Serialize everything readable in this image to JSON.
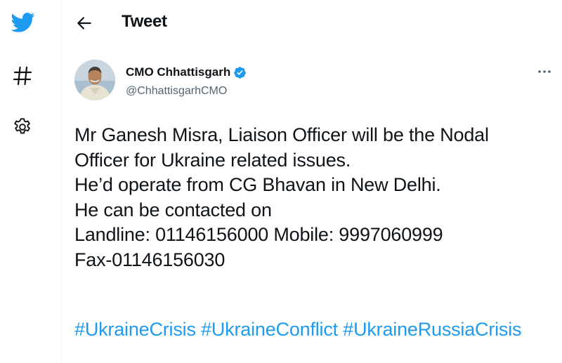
{
  "header": {
    "title": "Tweet"
  },
  "icons": {
    "logo": "twitter-bird-icon",
    "explore": "hashtag-icon",
    "settings": "gear-icon",
    "back": "back-arrow-icon",
    "verified": "verified-badge-icon",
    "more": "more-dots-icon"
  },
  "colors": {
    "accent": "#1d9bf0",
    "text": "#0f1419",
    "secondary_text": "#536471"
  },
  "tweet": {
    "author": {
      "display_name": "CMO Chhattisgarh",
      "handle": "@ChhattisgarhCMO",
      "verified": true
    },
    "lines": [
      "Mr Ganesh Misra, Liaison Officer will be the Nodal",
      "Officer for Ukraine related issues.",
      "He’d operate from CG Bhavan in New Delhi.",
      "He can be contacted on",
      "Landline:  01146156000 Mobile: 9997060999",
      "Fax-01146156030"
    ],
    "hashtags": [
      "#UkraineCrisis",
      "#UkraineConflict",
      "#UkraineRussiaCrisis"
    ]
  }
}
